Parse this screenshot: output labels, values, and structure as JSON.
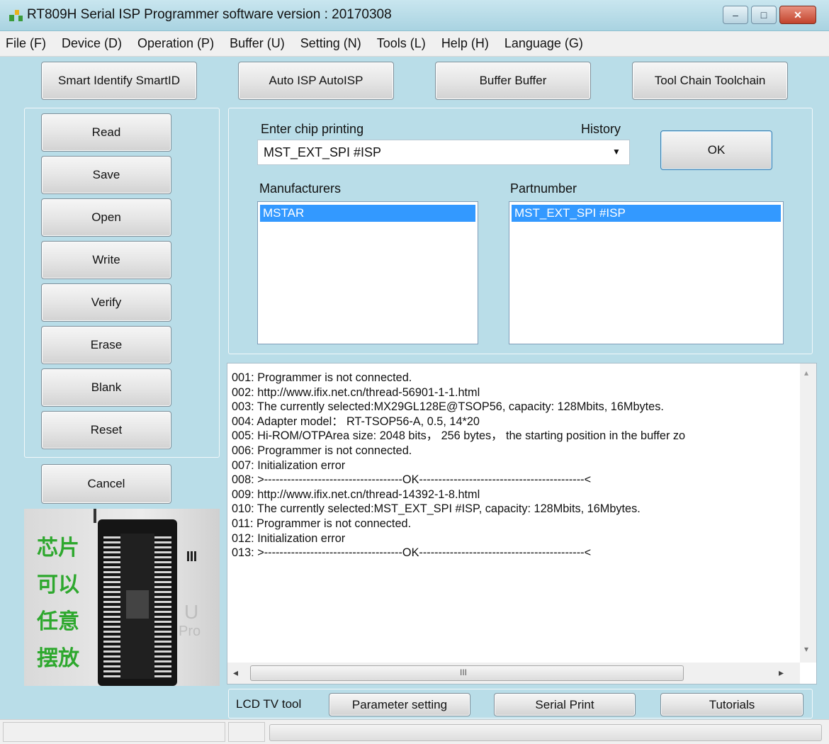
{
  "window": {
    "title": "RT809H Serial ISP Programmer software version : 20170308",
    "controls": {
      "minimize": "–",
      "maximize": "□",
      "close": "✕"
    }
  },
  "menu": [
    {
      "label": "File (F)"
    },
    {
      "label": "Device (D)"
    },
    {
      "label": "Operation (P)"
    },
    {
      "label": "Buffer (U)"
    },
    {
      "label": "Setting (N)"
    },
    {
      "label": "Tools (L)"
    },
    {
      "label": "Help (H)"
    },
    {
      "label": "Language (G)"
    }
  ],
  "toolbar": {
    "smart_identify": "Smart Identify SmartID",
    "auto_isp": "Auto ISP AutoISP",
    "buffer": "Buffer Buffer",
    "tool_chain": "Tool Chain Toolchain"
  },
  "side_buttons": [
    "Read",
    "Save",
    "Open",
    "Write",
    "Verify",
    "Erase",
    "Blank",
    "Reset"
  ],
  "cancel_label": "Cancel",
  "chip_image": {
    "caption_lines": [
      "芯片",
      "可以",
      "任意",
      "摆放"
    ]
  },
  "chip_select": {
    "label": "Enter chip printing",
    "history_label": "History",
    "value": "MST_EXT_SPI #ISP",
    "ok_label": "OK",
    "manufacturers_label": "Manufacturers",
    "manufacturers": [
      "MSTAR"
    ],
    "partnumber_label": "Partnumber",
    "partnumbers": [
      "MST_EXT_SPI #ISP"
    ]
  },
  "log": [
    "001: Programmer is not connected.",
    "002: http://www.ifix.net.cn/thread-56901-1-1.html",
    "003: The currently selected:MX29GL128E@TSOP56, capacity: 128Mbits, 16Mbytes.",
    "004: Adapter model： RT-TSOP56-A, 0.5, 14*20",
    "005: Hi-ROM/OTPArea size: 2048 bits， 256 bytes， the starting position in the buffer zo",
    "006: Programmer is not connected.",
    "007: Initialization error",
    "008: >------------------------------------OK-------------------------------------------<",
    "009: http://www.ifix.net.cn/thread-14392-1-8.html",
    "010: The currently selected:MST_EXT_SPI #ISP, capacity: 128Mbits, 16Mbytes.",
    "011: Programmer is not connected.",
    "012: Initialization error",
    "013: >------------------------------------OK-------------------------------------------<"
  ],
  "scrollbar": {
    "grip": "III",
    "left_arrow": "◂",
    "right_arrow": "▸",
    "up_arrow": "▴",
    "down_arrow": "▾"
  },
  "lcd_tools": {
    "label": "LCD TV tool",
    "parameter_setting": "Parameter setting",
    "serial_print": "Serial Print",
    "tutorials": "Tutorials"
  },
  "colors": {
    "background": "#b9dde8",
    "selection": "#3399ff",
    "close_button": "#c2432c"
  }
}
